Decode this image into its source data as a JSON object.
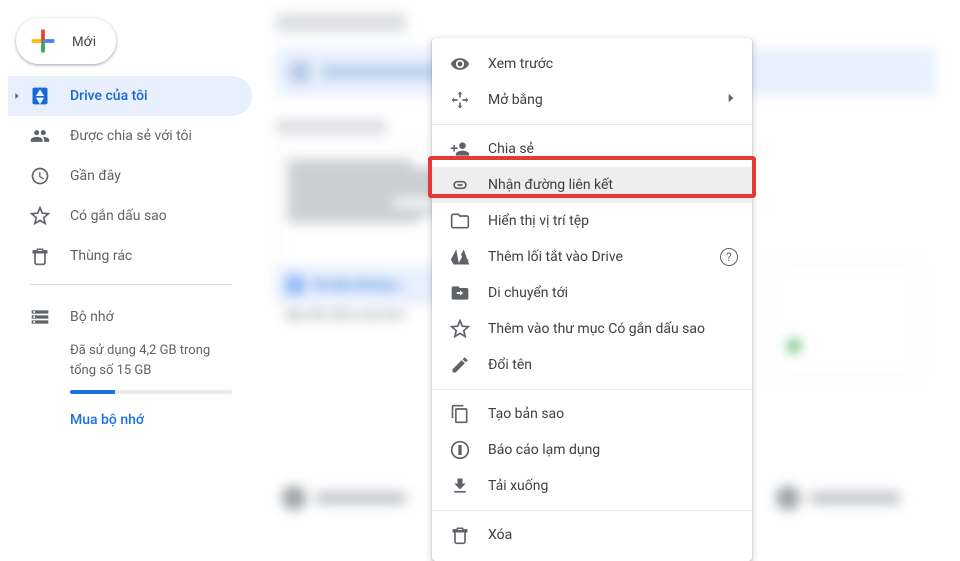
{
  "sidebar": {
    "new_label": "Mới",
    "items": [
      {
        "label": "Drive của tôi"
      },
      {
        "label": "Được chia sẻ với tôi"
      },
      {
        "label": "Gần đây"
      },
      {
        "label": "Có gắn dấu sao"
      },
      {
        "label": "Thùng rác"
      }
    ],
    "storage": {
      "label": "Bộ nhớ",
      "usage_text": "Đã sử dụng 4,2 GB trong tổng số 15 GB",
      "buy_label": "Mua bộ nhớ"
    }
  },
  "file_card": {
    "name": "Tài liệu không c",
    "subtitle": "Bạn đã chỉnh sửa hôm"
  },
  "context_menu": {
    "preview": "Xem trước",
    "open_with": "Mở bằng",
    "share": "Chia sẻ",
    "get_link": "Nhận đường liên kết",
    "show_location": "Hiển thị vị trí tệp",
    "add_shortcut": "Thêm lối tắt vào Drive",
    "move_to": "Di chuyển tới",
    "add_starred": "Thêm vào thư mục Có gắn dấu sao",
    "rename": "Đổi tên",
    "make_copy": "Tạo bản sao",
    "report_abuse": "Báo cáo lạm dụng",
    "download": "Tải xuống",
    "remove": "Xóa"
  }
}
